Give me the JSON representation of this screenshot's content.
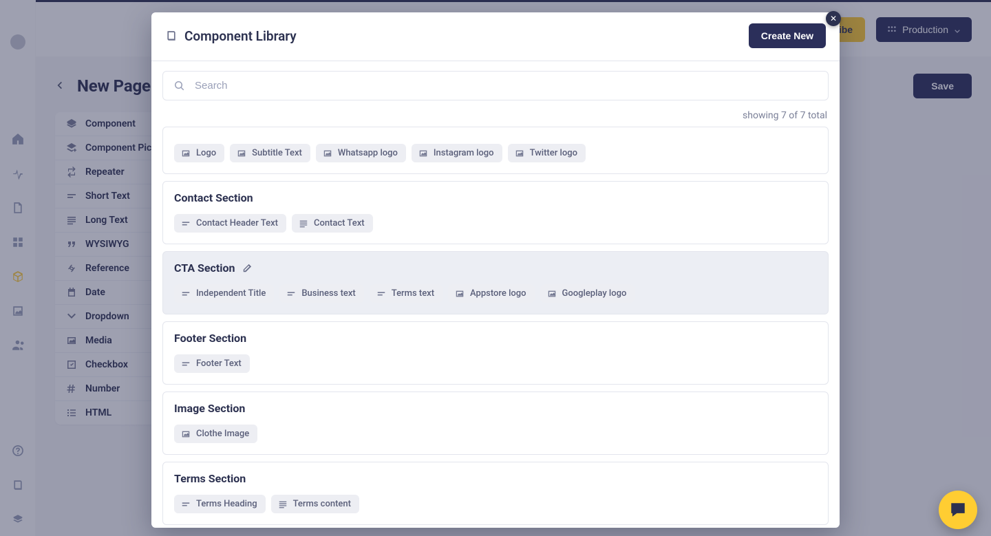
{
  "topbar": {
    "subscribe_label": "Subscribe",
    "env_label": "Production"
  },
  "page": {
    "title": "New Page",
    "save_label": "Save",
    "field_types": [
      {
        "icon": "layers",
        "label": "Component"
      },
      {
        "icon": "layers-plus",
        "label": "Component Picker"
      },
      {
        "icon": "repeat",
        "label": "Repeater"
      },
      {
        "icon": "short-text",
        "label": "Short Text"
      },
      {
        "icon": "long-text",
        "label": "Long Text"
      },
      {
        "icon": "quote",
        "label": "WYSIWYG"
      },
      {
        "icon": "link",
        "label": "Reference"
      },
      {
        "icon": "calendar",
        "label": "Date"
      },
      {
        "icon": "chevron-down",
        "label": "Dropdown"
      },
      {
        "icon": "media",
        "label": "Media"
      },
      {
        "icon": "check-square",
        "label": "Checkbox"
      },
      {
        "icon": "hash",
        "label": "Number"
      },
      {
        "icon": "list",
        "label": "HTML"
      }
    ]
  },
  "modal": {
    "title": "Component Library",
    "create_label": "Create New",
    "search_placeholder": "Search",
    "result_meta": "showing 7 of 7 total",
    "sections": [
      {
        "title": "",
        "partial_top": true,
        "hover": false,
        "fields": [
          {
            "icon": "media",
            "label": "Logo"
          },
          {
            "icon": "media",
            "label": "Subtitle Text"
          },
          {
            "icon": "media",
            "label": "Whatsapp logo"
          },
          {
            "icon": "media",
            "label": "Instagram logo"
          },
          {
            "icon": "media",
            "label": "Twitter logo"
          }
        ]
      },
      {
        "title": "Contact Section",
        "hover": false,
        "fields": [
          {
            "icon": "short-text",
            "label": "Contact Header Text"
          },
          {
            "icon": "long-text",
            "label": "Contact Text"
          }
        ]
      },
      {
        "title": "CTA Section",
        "hover": true,
        "fields": [
          {
            "icon": "short-text",
            "label": "Independent Title"
          },
          {
            "icon": "short-text",
            "label": "Business text"
          },
          {
            "icon": "short-text",
            "label": "Terms text"
          },
          {
            "icon": "media",
            "label": "Appstore logo"
          },
          {
            "icon": "media",
            "label": "Googleplay logo"
          }
        ]
      },
      {
        "title": "Footer Section",
        "hover": false,
        "fields": [
          {
            "icon": "short-text",
            "label": "Footer Text"
          }
        ]
      },
      {
        "title": "Image Section",
        "hover": false,
        "fields": [
          {
            "icon": "media",
            "label": "Clothe Image"
          }
        ]
      },
      {
        "title": "Terms Section",
        "hover": false,
        "fields": [
          {
            "icon": "short-text",
            "label": "Terms Heading"
          },
          {
            "icon": "long-text",
            "label": "Terms content"
          }
        ]
      }
    ]
  }
}
